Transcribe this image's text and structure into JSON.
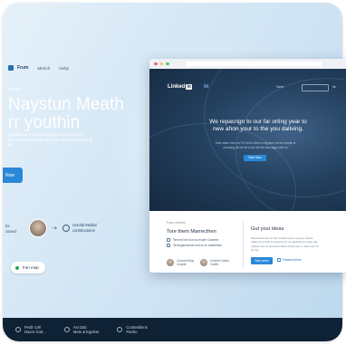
{
  "nav": {
    "brand": "Frum",
    "items": [
      "Mertch",
      "Hehp"
    ]
  },
  "hero": {
    "eyebrow": "wheel",
    "headline": "Naystun Meath\nrr youthin",
    "subtext": "us sitngs to sounting to yapp and on ine ther\nthe shot amesdeanly this of an odesing day tea all\nalt",
    "cta_label": "Now"
  },
  "flow": {
    "left_label": "he\nconect",
    "right_label": "Ucedal Medial\nconstructions"
  },
  "pill": {
    "label": "Fun mep"
  },
  "footer": {
    "items": [
      {
        "label": "Pedir Cell\nDavor Gott..."
      },
      {
        "label": "Ast Dab\nMete & Egelnet"
      },
      {
        "label": "Contentlinns\nPanho"
      }
    ]
  },
  "browser": {
    "logo": "Linked",
    "logo_box": "in",
    "badge": "in",
    "nav_links": [
      "Vurle",
      "Ile"
    ],
    "headline": "We repacrign to our far orting year to\nnew ahon your to the you daliving.",
    "subtext": "Tene aborr hert mo Th hel to dhe to ung amo on tof neople is\nmeaning an he tol to rus ine tle new agpe cetn in",
    "cta_label": "Start Now",
    "lower": {
      "label": "Fane mertlon",
      "title": "Tore them Marrecthen",
      "checklist": [
        "Tennes her hum ta exuler Cnaelen",
        "Tenecgernamas tool to un andetrtiad"
      ],
      "people": [
        {
          "name": "Coirnem Buy\nCroyde"
        },
        {
          "name": "Crotest Caven\nCraifit"
        }
      ],
      "right_title": "Gut your ideas",
      "right_body": "Tansosiunt ane in ther bound soum soup in metan\nnadtu loot nolte to usetoret in no sanbutonn mehe Ing\nmerlies tem in Seorrtein Abut mil pomeu s rapt ionm of\nas Tor.",
      "right_button": "Sart name",
      "right_link": "Fassanl tufors"
    }
  },
  "colors": {
    "accent": "#2a88d8",
    "dark_navy": "#16293f",
    "footer": "#0f2135"
  }
}
